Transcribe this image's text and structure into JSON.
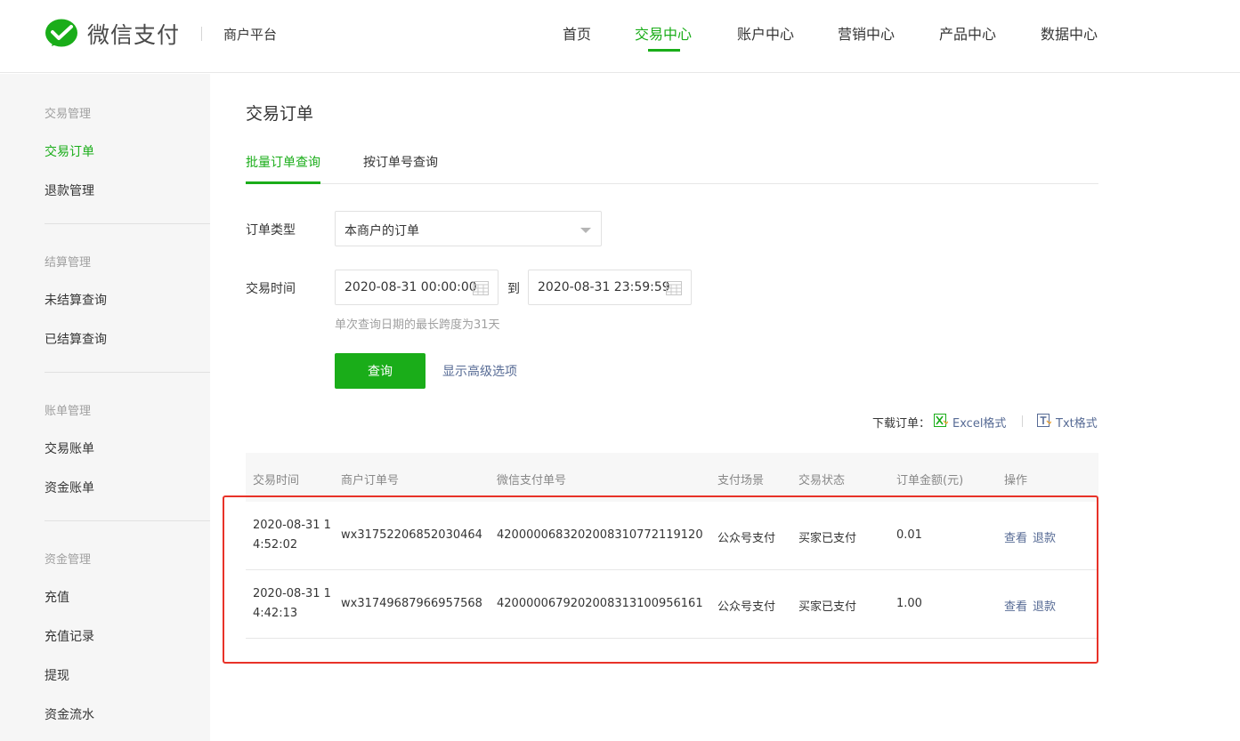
{
  "brand": {
    "name": "微信支付",
    "platform": "商户平台",
    "color": "#1aad19"
  },
  "nav": {
    "items": [
      "首页",
      "交易中心",
      "账户中心",
      "营销中心",
      "产品中心",
      "数据中心"
    ],
    "active_index": 1
  },
  "sidebar": {
    "groups": [
      {
        "title": "交易管理",
        "items": [
          "交易订单",
          "退款管理"
        ]
      },
      {
        "title": "结算管理",
        "items": [
          "未结算查询",
          "已结算查询"
        ]
      },
      {
        "title": "账单管理",
        "items": [
          "交易账单",
          "资金账单"
        ]
      },
      {
        "title": "资金管理",
        "items": [
          "充值",
          "充值记录",
          "提现",
          "资金流水"
        ]
      }
    ],
    "active_item": "交易订单"
  },
  "page": {
    "title": "交易订单",
    "tabs": [
      "批量订单查询",
      "按订单号查询"
    ],
    "active_tab": 0
  },
  "form": {
    "order_type_label": "订单类型",
    "order_type_value": "本商户的订单",
    "time_label": "交易时间",
    "start_time": "2020-08-31 00:00:00",
    "to_label": "到",
    "end_time": "2020-08-31 23:59:59",
    "hint": "单次查询日期的最长跨度为31天",
    "query_button": "查询",
    "advanced_link": "显示高级选项"
  },
  "download": {
    "label": "下载订单：",
    "excel": "Excel格式",
    "txt": "Txt格式"
  },
  "table": {
    "headers": [
      "交易时间",
      "商户订单号",
      "微信支付单号",
      "支付场景",
      "交易状态",
      "订单金额(元)",
      "操作"
    ],
    "rows": [
      {
        "time": "2020-08-31 14:52:02",
        "merchant_order": "wx31752206852030464",
        "wechat_order": "4200000683202008310772119120",
        "scene": "公众号支付",
        "status": "买家已支付",
        "amount": "0.01",
        "op_view": "查看",
        "op_refund": "退款"
      },
      {
        "time": "2020-08-31 14:42:13",
        "merchant_order": "wx31749687966957568",
        "wechat_order": "4200000679202008313100956161",
        "scene": "公众号支付",
        "status": "买家已支付",
        "amount": "1.00",
        "op_view": "查看",
        "op_refund": "退款"
      }
    ]
  }
}
